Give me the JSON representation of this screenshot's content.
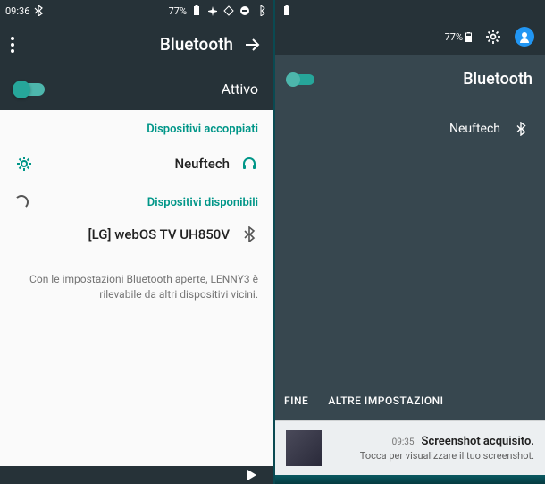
{
  "left": {
    "statusbar": {
      "time": "09:36",
      "battery": "77%"
    },
    "header": {
      "title": "Bluetooth"
    },
    "active_label": "Attivo",
    "sections": {
      "paired_header": "Dispositivi accoppiati",
      "available_header": "Dispositivi disponibili"
    },
    "paired_device": {
      "name": "Neuftech"
    },
    "available_device": {
      "name": "[LG] webOS TV UH850V"
    },
    "info_text": "Con le impostazioni Bluetooth aperte, LENNY3 è rilevabile da altri dispositivi vicini."
  },
  "right": {
    "statusbar": {
      "battery": "77%"
    },
    "header": {
      "title": "Bluetooth"
    },
    "device": {
      "name": "Neuftech"
    },
    "actions": {
      "fine": "FINE",
      "more": "ALTRE IMPOSTAZIONI"
    },
    "notification": {
      "title": "Screenshot acquisito.",
      "subtitle": "Tocca per visualizzare il tuo screenshot.",
      "time": "09:35"
    }
  }
}
